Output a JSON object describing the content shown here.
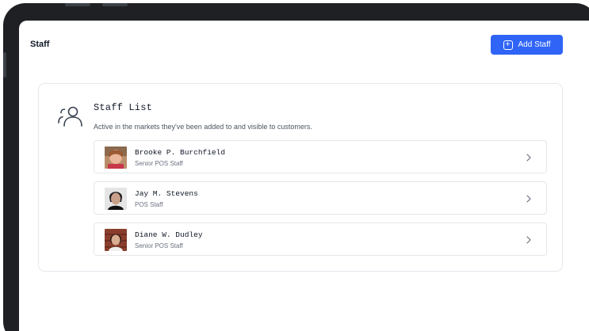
{
  "header": {
    "title": "Staff",
    "add_button_label": "Add Staff",
    "add_button_icon": "plus-square-icon",
    "accent_color": "#2f64f6"
  },
  "staff_list": {
    "title": "Staff List",
    "subtitle": "Active in the markets they've been added to and visible to customers.",
    "icon": "users-icon",
    "items": [
      {
        "name": "Brooke P. Burchfield",
        "role": "Senior POS Staff"
      },
      {
        "name": "Jay M. Stevens",
        "role": "POS Staff"
      },
      {
        "name": "Diane W. Dudley",
        "role": "Senior POS Staff"
      }
    ]
  }
}
